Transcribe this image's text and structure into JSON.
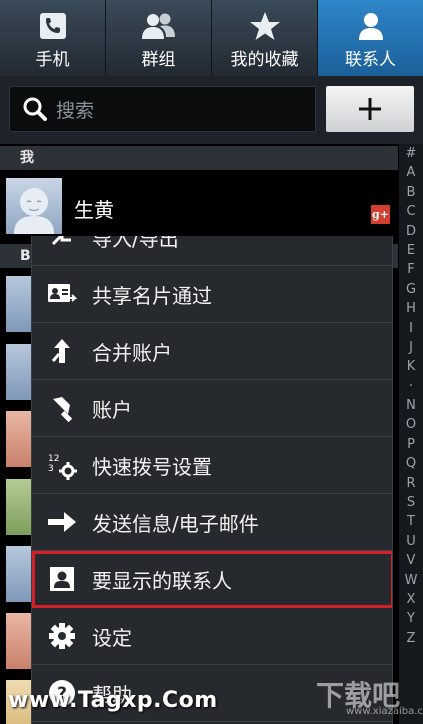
{
  "tabs": [
    {
      "label": "手机",
      "icon": "phone-icon",
      "active": false
    },
    {
      "label": "群组",
      "icon": "group-icon",
      "active": false
    },
    {
      "label": "我的收藏",
      "icon": "star-icon",
      "active": false
    },
    {
      "label": "联系人",
      "icon": "person-icon",
      "active": true
    }
  ],
  "search": {
    "placeholder": "搜索",
    "add_label": "+"
  },
  "sections": {
    "me_header": "我",
    "b_header": "B"
  },
  "me": {
    "name": "生黄",
    "badge": "g+"
  },
  "index_letters": [
    "#",
    "A",
    "B",
    "C",
    "D",
    "E",
    "F",
    "G",
    "H",
    "I",
    "J",
    "K",
    "·",
    "N",
    "O",
    "P",
    "Q",
    "R",
    "S",
    "T",
    "U",
    "V",
    "W",
    "X",
    "Y",
    "Z"
  ],
  "menu": {
    "items": [
      {
        "label": "导入/导出",
        "icon": "import-export-icon"
      },
      {
        "label": "共享名片通过",
        "icon": "share-card-icon"
      },
      {
        "label": "合并账户",
        "icon": "merge-icon"
      },
      {
        "label": "账户",
        "icon": "key-icon"
      },
      {
        "label": "快速拨号设置",
        "icon": "speed-dial-icon"
      },
      {
        "label": "发送信息/电子邮件",
        "icon": "arrow-right-icon"
      },
      {
        "label": "要显示的联系人",
        "icon": "contact-card-icon",
        "highlighted": true
      },
      {
        "label": "设定",
        "icon": "gear-icon"
      },
      {
        "label": "帮助",
        "icon": "help-icon"
      }
    ]
  },
  "watermarks": {
    "site": "www.Tagxp.Com",
    "logo": "下载吧",
    "logo_url": "www.xiazaiba.com"
  },
  "colors": {
    "active_tab": "#2e86c8",
    "highlight_border": "#d31f25",
    "menu_bg": "#26292d"
  }
}
